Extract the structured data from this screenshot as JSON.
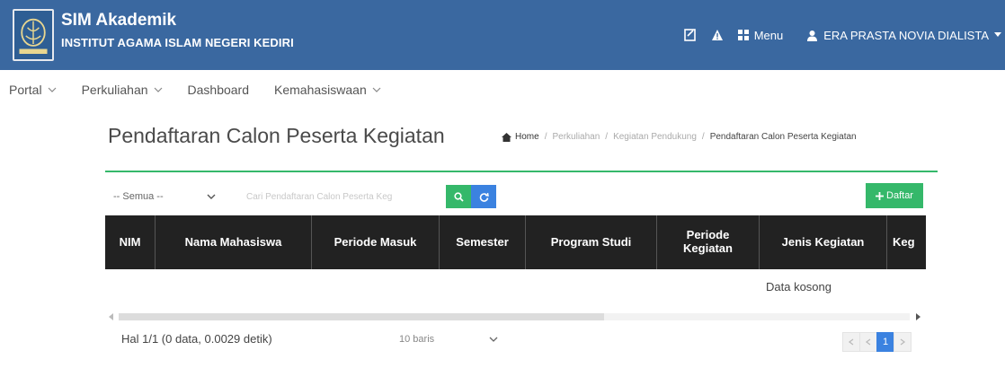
{
  "colors": {
    "header_bg": "#3a68a0",
    "accent_green": "#35b86a",
    "accent_blue": "#3b82e0",
    "table_header_bg": "#222222"
  },
  "header": {
    "title": "SIM Akademik",
    "subtitle": "INSTITUT AGAMA ISLAM NEGERI KEDIRI",
    "menu_label": "Menu",
    "user_name": "ERA PRASTA NOVIA DIALISTA",
    "icons": [
      "notes-icon",
      "warning-icon",
      "grid-icon",
      "user-icon",
      "caret-down-icon"
    ]
  },
  "nav": {
    "items": [
      {
        "label": "Portal",
        "dropdown": true
      },
      {
        "label": "Perkuliahan",
        "dropdown": true
      },
      {
        "label": "Dashboard",
        "dropdown": false
      },
      {
        "label": "Kemahasiswaan",
        "dropdown": true
      }
    ]
  },
  "page": {
    "title": "Pendaftaran Calon Peserta Kegiatan"
  },
  "breadcrumb": {
    "items": [
      "Home",
      "Perkuliahan",
      "Kegiatan Pendukung",
      "Pendaftaran Calon Peserta Kegiatan"
    ]
  },
  "filter": {
    "select_value": "-- Semua --",
    "search_placeholder": "Cari Pendaftaran Calon Peserta Keg",
    "add_label": "Daftar"
  },
  "table": {
    "columns": [
      "NIM",
      "Nama Mahasiswa",
      "Periode Masuk",
      "Semester",
      "Program Studi",
      "Periode Kegiatan",
      "Jenis Kegiatan",
      "Keg"
    ],
    "empty_text": "Data kosong"
  },
  "footer": {
    "page_info": "Hal 1/1 (0 data, 0.0029 detik)",
    "rows_select": "10 baris",
    "pager": {
      "current": "1"
    }
  }
}
